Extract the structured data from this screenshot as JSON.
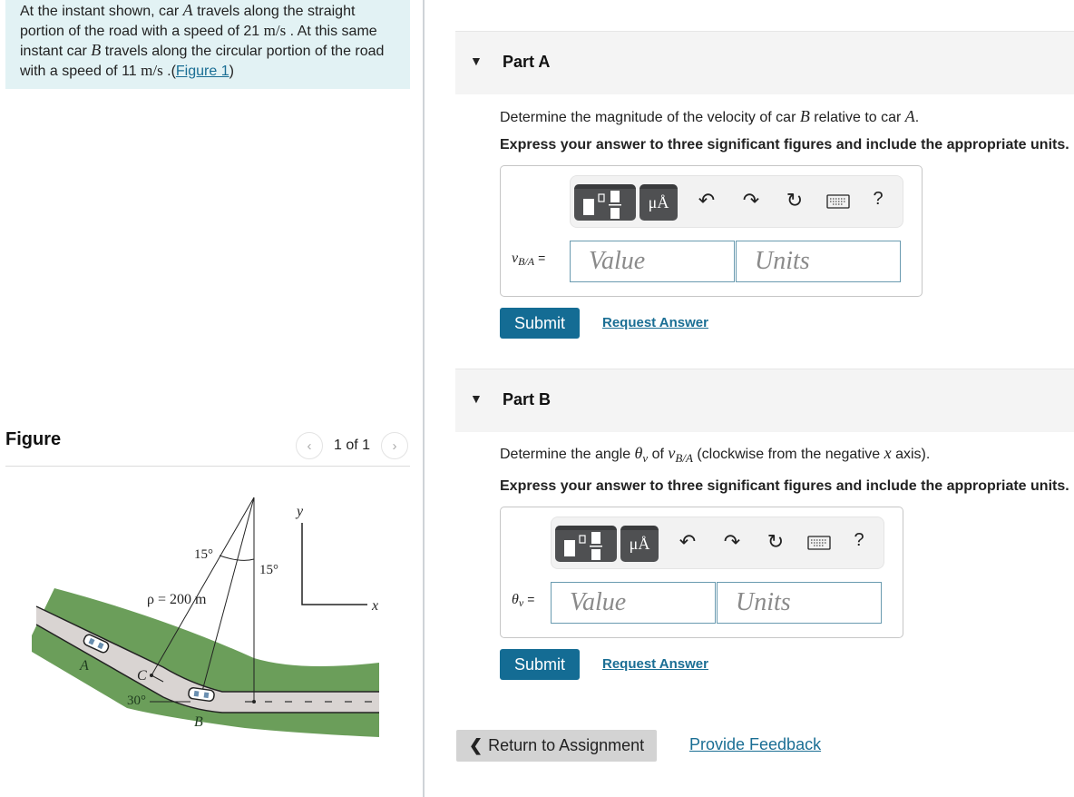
{
  "problem": {
    "intro_1": "At the instant shown, car ",
    "var_A": "A",
    "intro_2": " travels along the straight portion of the road with a speed of 21 ",
    "unit_1": "m/s",
    "intro_3": " . At this same instant car ",
    "var_B": "B",
    "intro_4": " travels along the circular portion of the road with a speed of 11 ",
    "unit_2": "m/s",
    "intro_5": " .(",
    "figure_link": "Figure 1",
    "intro_6": ")"
  },
  "figure_panel": {
    "title": "Figure",
    "pager_text": "1 of 1",
    "prev_icon": "chevron-left-icon",
    "next_icon": "chevron-right-icon",
    "labels": {
      "angle_left": "15°",
      "angle_right": "15°",
      "radius": "ρ = 200 m",
      "angle_bottom": "30°",
      "car_a": "A",
      "car_b": "B",
      "point_c": "C",
      "axis_x": "x",
      "axis_y": "y"
    },
    "colors": {
      "grass": "#6b9e5a",
      "road": "#d9d4d2"
    }
  },
  "parts": [
    {
      "title": "Part A",
      "question_1": "Determine the magnitude of the velocity of car ",
      "q_var_1": "B",
      "question_2": " relative to car ",
      "q_var_2": "A",
      "question_3": ".",
      "instruction": "Express your answer to three significant figures and include the appropriate units.",
      "answer_label": "v",
      "answer_sub": "B/A",
      "value_placeholder": "Value",
      "units_placeholder": "Units",
      "submit_label": "Submit",
      "request_label": "Request Answer"
    },
    {
      "title": "Part B",
      "question_1": "Determine the angle ",
      "q_var_1": "θ",
      "q_var_1_sub": "v",
      "question_2": " of ",
      "q_var_2": "v",
      "q_var_2_sub": "B/A",
      "question_3": " (clockwise from the negative ",
      "q_var_3": "x",
      "question_4": " axis).",
      "instruction": "Express your answer to three significant figures and include the appropriate units.",
      "answer_label": "θ",
      "answer_sub": "v",
      "value_placeholder": "Value",
      "units_placeholder": "Units",
      "submit_label": "Submit",
      "request_label": "Request Answer"
    }
  ],
  "toolbar": {
    "templates_icon": "fraction-templates-icon",
    "units_icon_text": "μÅ",
    "undo": "↶",
    "redo": "↷",
    "reset": "↻",
    "help": "?"
  },
  "footer": {
    "return_label": "Return to Assignment",
    "feedback_label": "Provide Feedback"
  },
  "colors": {
    "accent": "#146c94",
    "link": "#1a6e94",
    "intro_bg": "#e2f2f4",
    "part_header_bg": "#f4f4f4"
  }
}
